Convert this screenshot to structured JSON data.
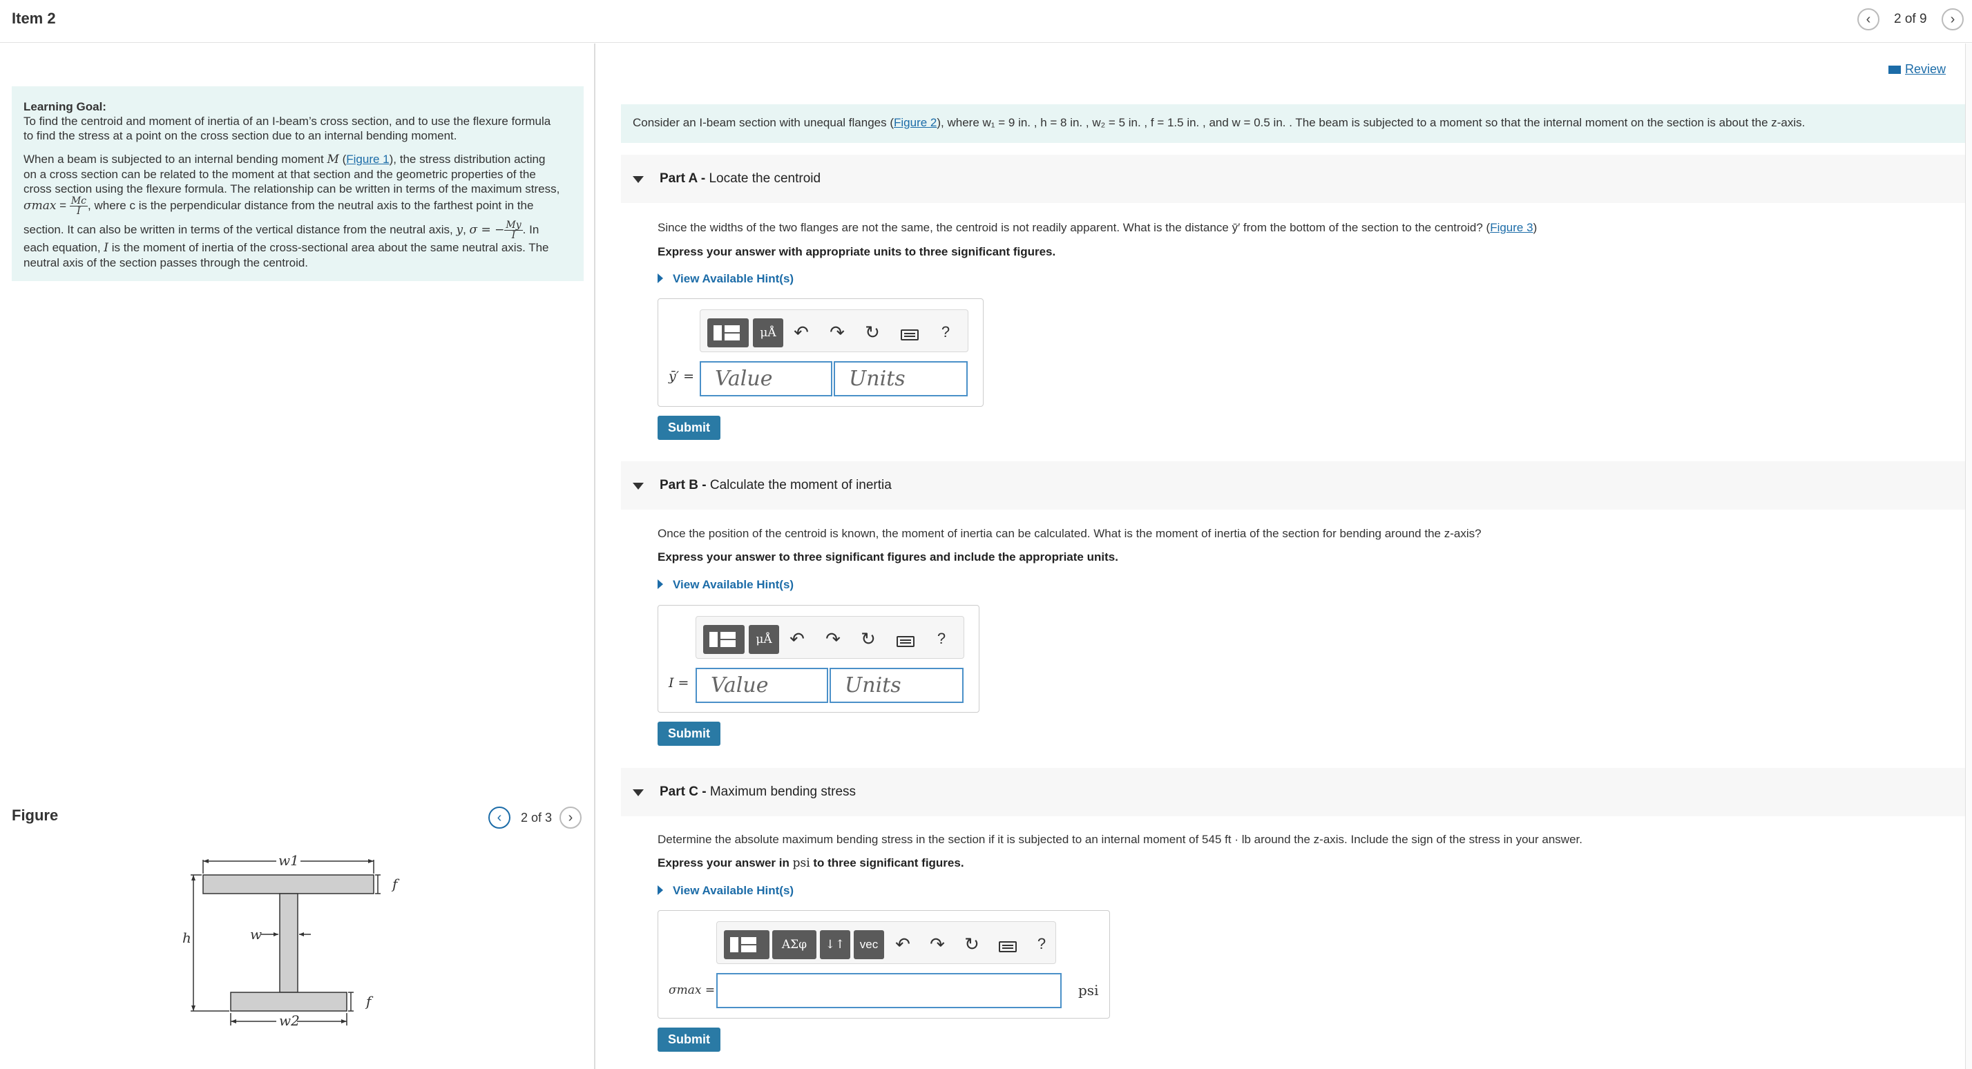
{
  "header": {
    "item_title": "Item 2",
    "counter": "2 of 9",
    "prev_icon": "chevron-left-icon",
    "next_icon": "chevron-right-icon"
  },
  "learning_goal": {
    "heading": "Learning Goal:",
    "goal_line1": "To find the centroid and moment of inertia of an I-beam’s cross section, and to use the flexure formula",
    "goal_line2": "to find the stress at a point on the cross section due to an internal bending moment.",
    "p2_a": "When a beam is subjected to an internal bending moment ",
    "p2_M": "M",
    "p2_link": "Figure 1",
    "p2_b": "), the stress distribution acting",
    "p2_line2": "on a cross section can be related to the moment at that section and the geometric properties of the",
    "p2_line3": "cross section using the flexure formula. The relationship can be written in terms of the maximum stress,",
    "sigma_max": "σmax",
    "eq": " = ",
    "frac1_num": "Mc",
    "frac1_den": "I",
    "p2_line4": ", where c is the perpendicular distance from the neutral axis to the farthest point in the",
    "p2_line5a": "section. It can also be written in terms of the vertical distance from the neutral axis, ",
    "p2_y": "y",
    "p2_sigma": "σ = −",
    "frac2_num": "My",
    "frac2_den": "I",
    "p2_line5b": ". In",
    "p2_line6a": "each equation, ",
    "p2_I": "I",
    "p2_line6b": " is the moment of inertia of the cross-sectional area about the same neutral axis. The",
    "p2_line7": "neutral axis of the section passes through the centroid."
  },
  "figure": {
    "title": "Figure",
    "counter": "2 of 3",
    "labels": {
      "w1": "w1",
      "w": "w",
      "h": "h",
      "f": "f",
      "w2": "w2"
    }
  },
  "review": {
    "label": "Review",
    "icon": "book-icon"
  },
  "intro": {
    "text_a": "Consider an I-beam section with unequal flanges (",
    "link": "Figure 2",
    "text_b": "), where w₁ = 9 in. , h = 8 in. , w₂ = 5 in. , f = 1.5 in. , and w = 0.5 in. . The beam is subjected to a moment so that the internal moment on the section is about the z-axis."
  },
  "part_a": {
    "title_bold": "Part A - ",
    "title": "Locate the centroid",
    "question_a": "Since the widths of the two flanges are not the same, the centroid is not readily apparent. What is the distance ȳ′ from the bottom of the section to the centroid? (",
    "question_link": "Figure 3",
    "question_b": ")",
    "instruction": "Express your answer with appropriate units to three significant figures.",
    "hint": "View Available Hint(s)",
    "field_label": "ȳ′ =",
    "value_placeholder": "Value",
    "units_placeholder": "Units",
    "submit": "Submit"
  },
  "part_b": {
    "title_bold": "Part B - ",
    "title": "Calculate the moment of inertia",
    "question": "Once the position of the centroid is known, the moment of inertia can be calculated. What is the moment of inertia of the section for bending around the z-axis?",
    "instruction": "Express your answer to three significant figures and include the appropriate units.",
    "hint": "View Available Hint(s)",
    "field_label": "I =",
    "value_placeholder": "Value",
    "units_placeholder": "Units",
    "submit": "Submit"
  },
  "part_c": {
    "title_bold": "Part C - ",
    "title": "Maximum bending stress",
    "question": "Determine the absolute maximum bending stress in the section if it is subjected to an internal moment of 545 ft · lb around the z-axis. Include the sign of the stress in your answer.",
    "instruction_a": "Express your answer in ",
    "instruction_unit": "psi",
    "instruction_b": " to three significant figures.",
    "hint": "View Available Hint(s)",
    "field_label": "σmax =",
    "unit": "psi",
    "submit": "Submit"
  },
  "toolbar": {
    "mu_a": "μÅ",
    "greek": "ΑΣφ",
    "arrows": "↓↑",
    "vec": "vec",
    "help": "?"
  }
}
